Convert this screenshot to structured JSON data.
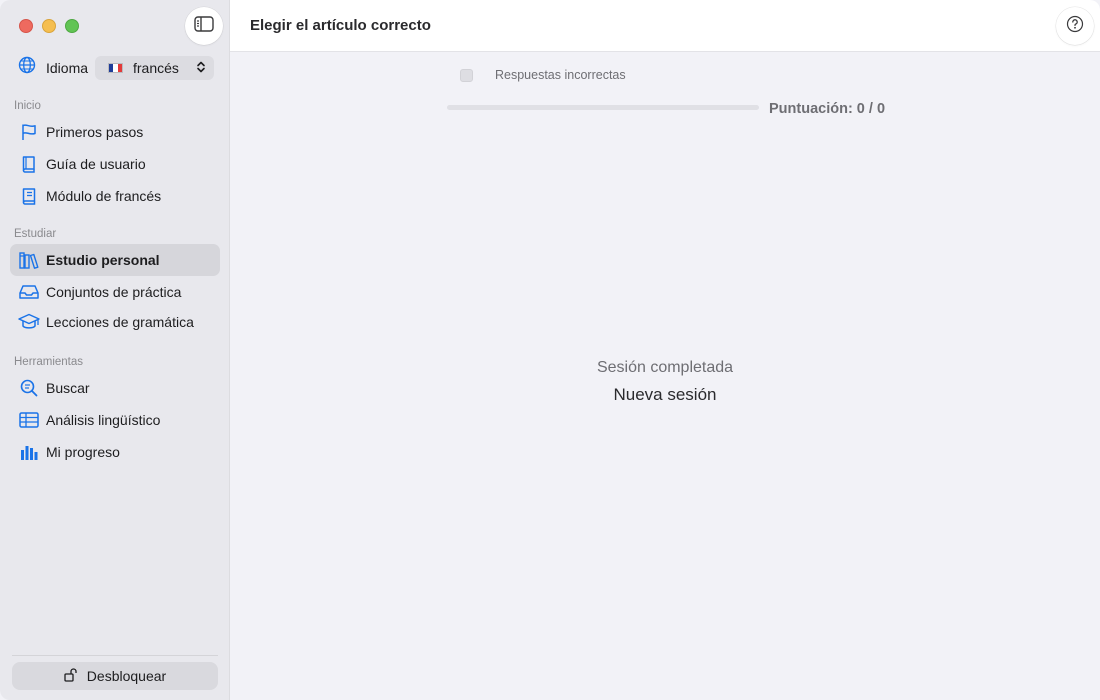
{
  "window": {
    "traffic_lights": [
      "close",
      "minimize",
      "maximize"
    ],
    "colors": {
      "close": "#ee6a5f",
      "minimize": "#f5be4f",
      "maximize": "#61c454",
      "accent": "#1a73e8"
    }
  },
  "sidebar": {
    "toggle_icon": "sidebar-left-icon",
    "language": {
      "label": "Idioma",
      "icon": "globe-icon",
      "selected": "francés",
      "flag": "france-flag"
    },
    "sections": [
      {
        "header": "Inicio",
        "items": [
          {
            "label": "Primeros pasos",
            "icon": "flag-icon"
          },
          {
            "label": "Guía de usuario",
            "icon": "book-icon"
          },
          {
            "label": "Módulo de francés",
            "icon": "book-text-icon"
          }
        ]
      },
      {
        "header": "Estudiar",
        "items": [
          {
            "label": "Estudio personal",
            "icon": "books-icon",
            "active": true
          },
          {
            "label": "Conjuntos de práctica",
            "icon": "tray-icon"
          },
          {
            "label": "Lecciones de gramática",
            "icon": "graduation-cap-icon"
          }
        ]
      },
      {
        "header": "Herramientas",
        "items": [
          {
            "label": "Buscar",
            "icon": "search-icon"
          },
          {
            "label": "Análisis lingüístico",
            "icon": "table-icon"
          },
          {
            "label": "Mi progreso",
            "icon": "bar-chart-icon"
          }
        ]
      }
    ],
    "unlock": {
      "label": "Desbloquear",
      "icon": "unlock-icon"
    }
  },
  "main": {
    "title": "Elegir el artículo correcto",
    "help_icon": "help-icon",
    "wrong_answers_label": "Respuestas incorrectas",
    "wrong_answers_checked": false,
    "progress": 0,
    "score": "Puntuación: 0 / 0",
    "session_status": "Sesión completada",
    "new_session": "Nueva sesión"
  }
}
